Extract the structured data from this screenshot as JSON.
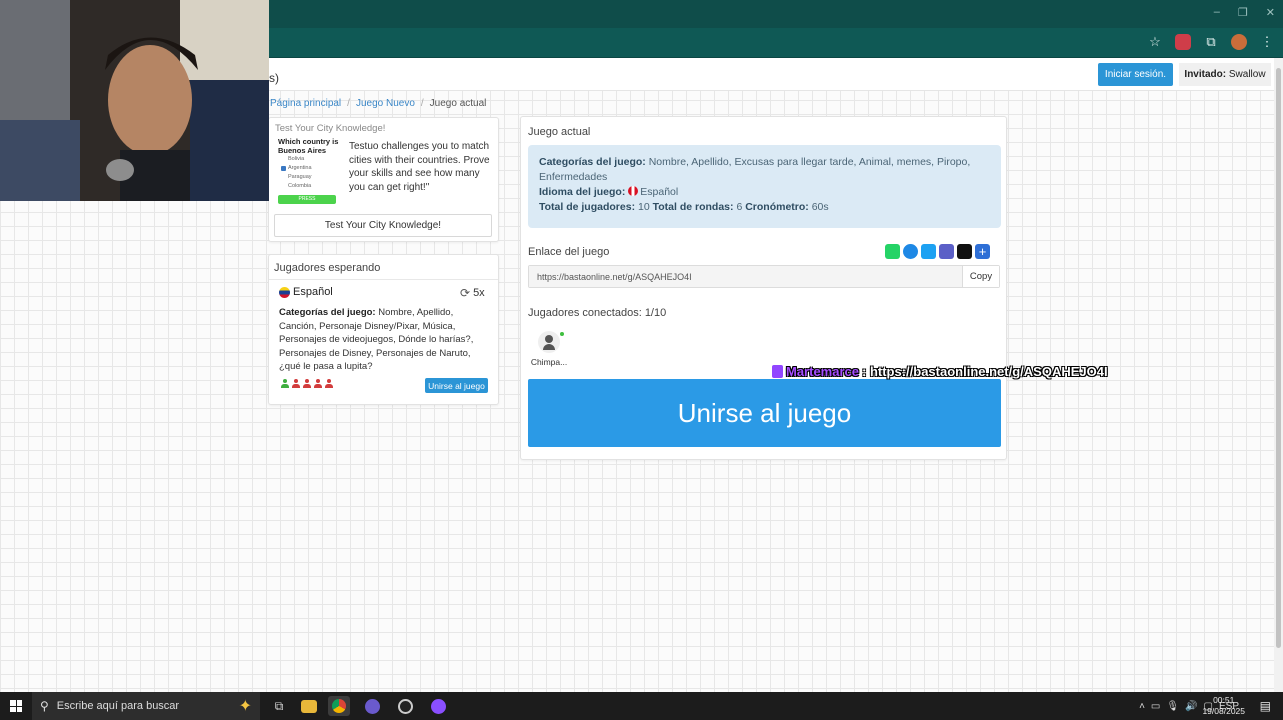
{
  "browser": {
    "window_controls": [
      "–",
      "❐",
      "✕"
    ],
    "toolbar_icons": [
      "star-icon",
      "extension-icon",
      "puzzle-icon",
      "profile-icon",
      "menu-icon"
    ]
  },
  "header": {
    "partial_text": "s)",
    "login_label": "Iniciar sesión.",
    "guest_label": "Invitado:",
    "guest_name": "Swallow"
  },
  "breadcrumb": {
    "home": "Página principal",
    "sep": "/",
    "new_game": "Juego Nuevo",
    "current": "Juego actual"
  },
  "ad": {
    "title": "Test Your City Knowledge!",
    "thumb_question": "Which country is Buenos Aires",
    "thumb_options": [
      "Bolivia",
      "Argentina",
      "Paraguay",
      "Colombia"
    ],
    "thumb_button": "PRESS",
    "text": "Testuo challenges you to match cities with their countries. Prove your skills and see how many you can get right!\"",
    "button": "Test Your City Knowledge!"
  },
  "waiting": {
    "title": "Jugadores esperando",
    "language": "Español",
    "rounds": "5x",
    "categories_label": "Categorías del juego:",
    "categories": "Nombre, Apellido, Canción, Personaje Disney/Pixar, Música, Personajes de videojuegos, Dónde lo harías?, Personajes de Disney, Personajes de Naruto, ¿qué le pasa a lupita?",
    "slots": [
      "on",
      "off",
      "off",
      "off",
      "off"
    ],
    "join_label": "Unirse al juego"
  },
  "game": {
    "title": "Juego actual",
    "categories_label": "Categorías del juego:",
    "categories": "Nombre, Apellido, Excusas para llegar tarde, Animal, memes, Piropo, Enfermedades",
    "language_label": "Idioma del juego:",
    "language": "Español",
    "players_total_label": "Total de jugadores:",
    "players_total": "10",
    "rounds_label": "Total de rondas:",
    "rounds": "6",
    "timer_label": "Cronómetro:",
    "timer": "60s",
    "link_label": "Enlace del juego",
    "share_icons": [
      "whatsapp-icon",
      "messenger-icon",
      "twitter-icon",
      "teams-icon",
      "snapchat-icon",
      "add-icon"
    ],
    "url": "https://bastaonline.net/g/ASQAHEJO4I",
    "copy_label": "Copy",
    "connected_label": "Jugadores conectados:",
    "connected": "1/10",
    "player_name": "Chimpa...",
    "join_label": "Unirse al juego"
  },
  "chat": {
    "user": "Martemarce",
    "message": ": https://bastaonline.net/g/ASQAHEJO4I"
  },
  "taskbar": {
    "search_placeholder": "Escribe aquí para buscar",
    "lang": "ESP",
    "time": "00:51",
    "date": "19/08/2025"
  },
  "colors": {
    "primary": "#2b95d6",
    "info_bg": "#dbeaf5",
    "browser_bar": "#0f5955"
  }
}
